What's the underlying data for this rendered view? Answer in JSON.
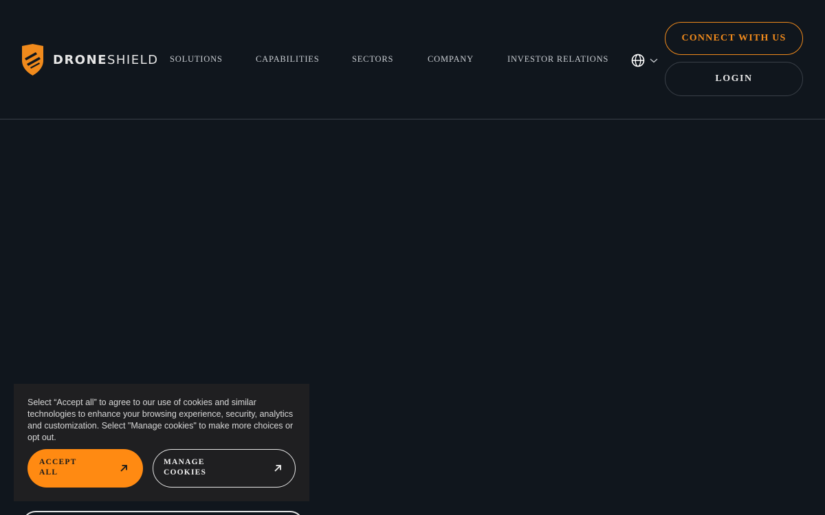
{
  "header": {
    "logo": {
      "text_bold": "DRONE",
      "text_regular": "SHIELD",
      "icon": "shield-logo-icon",
      "accent": "#f08a1c"
    },
    "nav": [
      {
        "label": "SOLUTIONS"
      },
      {
        "label": "CAPABILITIES"
      },
      {
        "label": "SECTORS"
      },
      {
        "label": "COMPANY"
      },
      {
        "label": "INVESTOR RELATIONS"
      }
    ],
    "language_icon": "globe-icon",
    "dropdown_icon": "chevron-down-icon",
    "connect_label": "CONNECT WITH US",
    "login_label": "LOGIN"
  },
  "cookie_banner": {
    "text": "Select “Accept all” to agree to our use of cookies and similar technologies to enhance your browsing experience, security, analytics and customization. Select \"Manage cookies\" to make more choices or opt out.",
    "accept_line1": "ACCEPT",
    "accept_line2": "ALL",
    "manage_line1": "MANAGE",
    "manage_line2": "COOKIES",
    "arrow_icon": "arrow-up-right-icon",
    "accept_color": "#ff8a12"
  },
  "colors": {
    "background": "#10161d",
    "accent": "#f08a1c"
  }
}
